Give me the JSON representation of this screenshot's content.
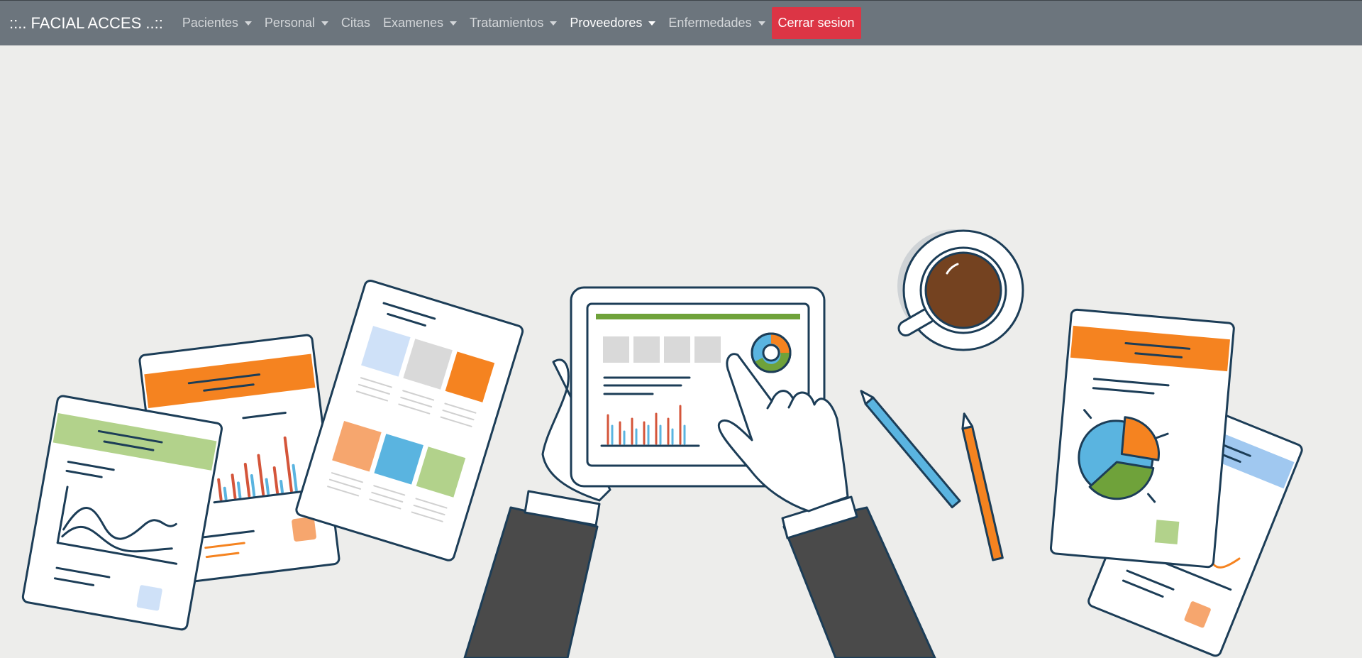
{
  "navbar": {
    "brand": "::.. FACIAL ACCES ..::",
    "items": [
      {
        "label": "Pacientes"
      },
      {
        "label": "Personal"
      },
      {
        "label": "Citas"
      },
      {
        "label": "Examenes"
      },
      {
        "label": "Tratamientos"
      },
      {
        "label": "Proveedores"
      },
      {
        "label": "Enfermedades"
      }
    ],
    "logout_label": "Cerrar sesion"
  },
  "colors": {
    "navbar": "#6c757d",
    "logout": "#dc3545",
    "background": "#ededeb",
    "accent_orange": "#f58320",
    "accent_green": "#6fa23a",
    "accent_blue": "#5ab4e0",
    "outline": "#1c3d57"
  },
  "illustration": {
    "description_icon": "business-analytics-illustration"
  }
}
